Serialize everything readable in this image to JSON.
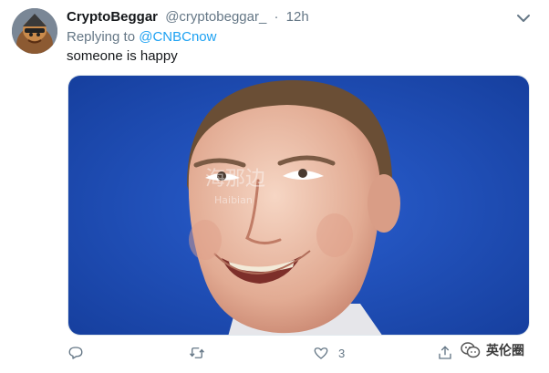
{
  "tweet": {
    "author_name": "CryptoBeggar",
    "author_handle": "@cryptobeggar_",
    "separator": "·",
    "time": "12h",
    "replying_prefix": "Replying to ",
    "replying_to": "@CNBCnow",
    "text": "someone is happy",
    "media_description_icon": "photo-of-smiling-man",
    "image_watermark": "海那边",
    "image_watermark_sub": "Haibian"
  },
  "actions": {
    "reply_count": "",
    "retweet_count": "",
    "like_count": "3",
    "share_count": ""
  },
  "watermark": {
    "label": "英伦圈",
    "icon": "wechat-icon"
  },
  "colors": {
    "link": "#1da1f2",
    "secondary_text": "#657786",
    "image_background": "#1f4bb8"
  }
}
